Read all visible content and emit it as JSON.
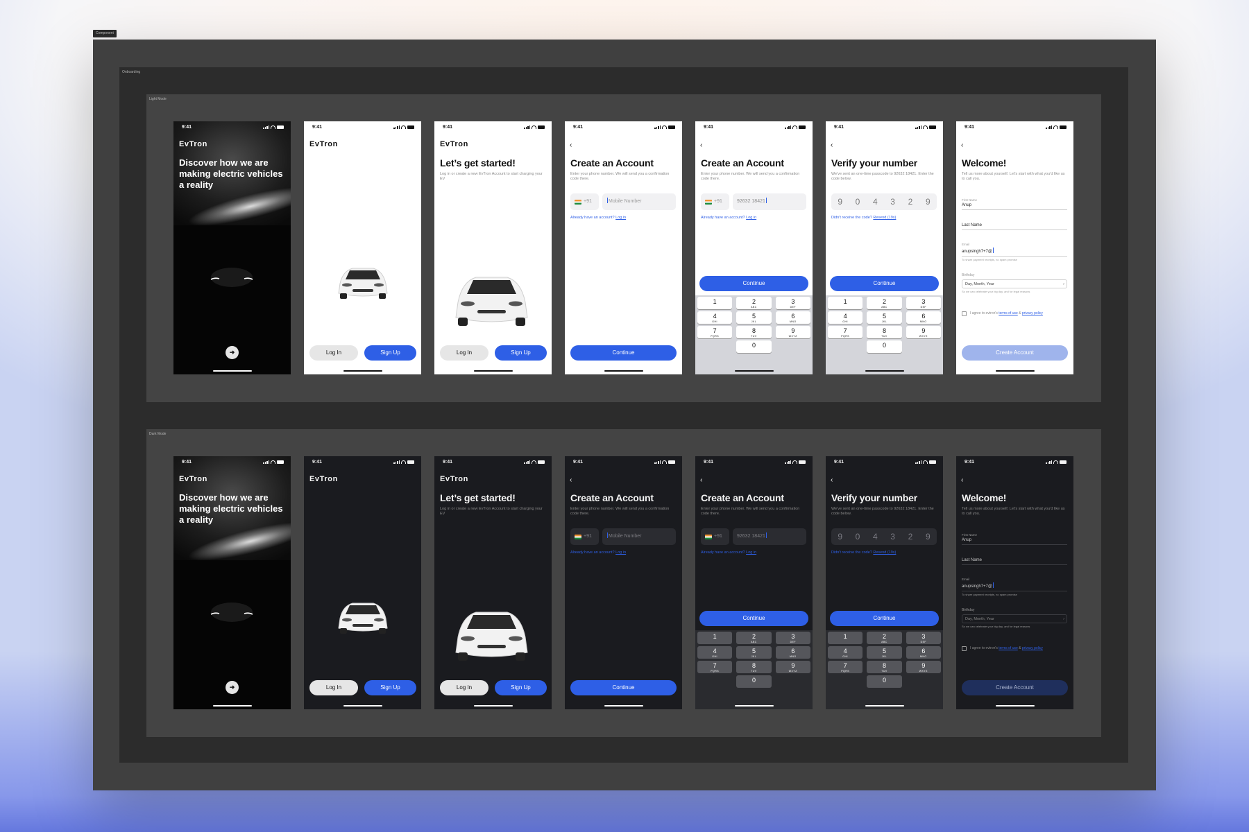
{
  "canvas": {
    "frame_tag": "Component",
    "section_tag": "Onboarding"
  },
  "sections": [
    {
      "key": "light",
      "label": "Light Mode"
    },
    {
      "key": "dark",
      "label": "Dark Mode"
    }
  ],
  "status": {
    "time": "9:41"
  },
  "brand": "EvTron",
  "splash": {
    "heading": "Discover how we are making electric vehicles a reality",
    "next_icon": "arrow-right-icon"
  },
  "home": {
    "login": "Log In",
    "signup": "Sign Up"
  },
  "start": {
    "heading": "Let’s get started!",
    "sub": "Log in or create a new EvTron Account to start charging your EV"
  },
  "create": {
    "heading": "Create an Account",
    "sub": "Enter your phone number. We will send you a confirmation code there.",
    "country_code": "+91",
    "mobile_placeholder": "Mobile Number",
    "mobile_value": "92632 18421",
    "login_prompt": "Already have an account?",
    "login_link": "Log in",
    "continue": "Continue"
  },
  "verify": {
    "heading": "Verify your number",
    "sub": "We've sent an one-time passcode to 92632 18421. Enter the code below.",
    "digits": [
      "9",
      "0",
      "4",
      "3",
      "2",
      "9"
    ],
    "resend_prompt": "Didn't receive the code?",
    "resend_link": "Resend (19s)",
    "continue": "Continue"
  },
  "keypad": {
    "keys": [
      {
        "d": "1",
        "l": ""
      },
      {
        "d": "2",
        "l": "ABC"
      },
      {
        "d": "3",
        "l": "DEF"
      },
      {
        "d": "4",
        "l": "GHI"
      },
      {
        "d": "5",
        "l": "JKL"
      },
      {
        "d": "6",
        "l": "MNO"
      },
      {
        "d": "7",
        "l": "PQRS"
      },
      {
        "d": "8",
        "l": "TUV"
      },
      {
        "d": "9",
        "l": "WXYZ"
      },
      {
        "d": "0",
        "l": ""
      }
    ]
  },
  "welcome": {
    "heading": "Welcome!",
    "sub": "Tell us more about yourself. Let's start with what you'd like us to call you.",
    "first_name_label": "First Name",
    "first_name_value": "Anup",
    "last_name_placeholder": "Last Name",
    "email_label": "Email",
    "email_value": "anupsingh7+7@",
    "email_hint": "To share payment receipts, no spam promise",
    "birthday_label": "Birthday",
    "birthday_placeholder": "Day, Month, Year",
    "birthday_hint": "So we can celebrate your big day, and for legal reasons",
    "agree_prefix": "I agree to evtron's",
    "agree_terms": "terms of use",
    "agree_and": "&",
    "agree_privacy": "privacy policy",
    "create": "Create Account"
  },
  "colors": {
    "accent": "#2e5fe6",
    "frame": "#404040",
    "dark_phone": "#1a1b1f"
  }
}
